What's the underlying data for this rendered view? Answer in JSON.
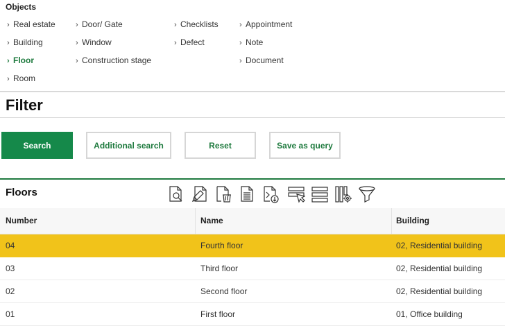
{
  "objects": {
    "title": "Objects",
    "columns": [
      [
        {
          "label": "Real estate",
          "active": false
        },
        {
          "label": "Building",
          "active": false
        },
        {
          "label": "Floor",
          "active": true
        },
        {
          "label": "Room",
          "active": false
        }
      ],
      [
        {
          "label": "Door/ Gate",
          "active": false
        },
        {
          "label": "Window",
          "active": false
        },
        {
          "label": "Construction stage",
          "active": false
        }
      ],
      [
        {
          "label": "Checklists",
          "active": false
        },
        {
          "label": "Defect",
          "active": false
        }
      ],
      [
        {
          "label": "Appointment",
          "active": false
        },
        {
          "label": "Note",
          "active": false
        },
        {
          "label": "Document",
          "active": false
        }
      ]
    ]
  },
  "filter": {
    "title": "Filter",
    "buttons": {
      "search": "Search",
      "additional_search": "Additional search",
      "reset": "Reset",
      "save_as_query": "Save as query"
    }
  },
  "floors": {
    "title": "Floors",
    "toolbar_icons": [
      "view-document-icon",
      "edit-document-icon",
      "delete-document-icon",
      "new-document-icon",
      "export-document-icon",
      "select-rows-icon",
      "list-rows-icon",
      "column-settings-icon",
      "filter-funnel-icon"
    ],
    "columns": [
      "Number",
      "Name",
      "Building"
    ],
    "rows": [
      {
        "number": "04",
        "name": "Fourth floor",
        "building": "02, Residential building",
        "selected": true
      },
      {
        "number": "03",
        "name": "Third floor",
        "building": "02, Residential building",
        "selected": false
      },
      {
        "number": "02",
        "name": "Second floor",
        "building": "02, Residential building",
        "selected": false
      },
      {
        "number": "01",
        "name": "First floor",
        "building": "01, Office building",
        "selected": false
      }
    ]
  },
  "colors": {
    "accent_green": "#15894a",
    "active_link_green": "#1e7a3e",
    "selected_row": "#f1c31a"
  }
}
